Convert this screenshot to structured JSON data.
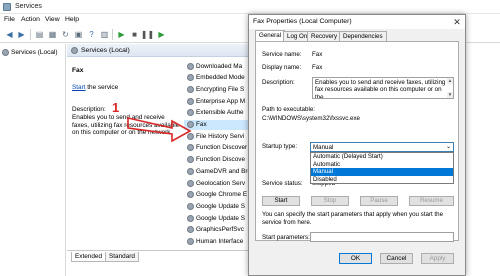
{
  "window": {
    "title": "Services",
    "menu": [
      "File",
      "Action",
      "View",
      "Help"
    ]
  },
  "tree": {
    "root": "Services (Local)"
  },
  "content": {
    "header": "Services (Local)",
    "service_name": "Fax",
    "start_link": "Start",
    "start_suffix": " the service",
    "description_label": "Description:",
    "description_text": "Enables you to send and receive faxes, utilizing fax resources available on this computer or on the network."
  },
  "service_list": [
    "Downloaded Ma",
    "Embedded Mode",
    "Encrypting File S",
    "Enterprise App M",
    "Extensible Authe",
    "Fax",
    "File History Servi",
    "Function Discover",
    "Function Discove",
    "GameDVR and Bro",
    "Geolocation Serv",
    "Google Chrome E",
    "Google Update S",
    "Google Update S",
    "GraphicsPerfSvc",
    "Human Interface"
  ],
  "bottom_tabs": [
    "Extended",
    "Standard"
  ],
  "annotations": {
    "one": "1",
    "two": "2"
  },
  "dialog": {
    "title": "Fax Properties (Local Computer)",
    "close_symbol": "✕",
    "tabs": [
      "General",
      "Log On",
      "Recovery",
      "Dependencies"
    ],
    "service_name_label": "Service name:",
    "service_name_value": "Fax",
    "display_name_label": "Display name:",
    "display_name_value": "Fax",
    "description_label": "Description:",
    "description_value": "Enables you to send and receive faxes, utilizing fax resources available on this computer or on the",
    "path_label": "Path to executable:",
    "path_value": "C:\\WINDOWS\\system32\\fxssvc.exe",
    "startup_type_label": "Startup type:",
    "startup_type_value": "Manual",
    "startup_options": [
      "Automatic (Delayed Start)",
      "Automatic",
      "Manual",
      "Disabled"
    ],
    "highlighted_option": "Manual",
    "service_status_label": "Service status:",
    "service_status_value": "Stopped",
    "buttons": {
      "start": "Start",
      "stop": "Stop",
      "pause": "Pause",
      "resume": "Resume"
    },
    "hint": "You can specify the start parameters that apply when you start the service from here.",
    "start_params_label": "Start parameters:",
    "footer": {
      "ok": "OK",
      "cancel": "Cancel",
      "apply": "Apply"
    }
  },
  "colors": {
    "annotation_red": "#d92828",
    "selection": "#0078d7"
  }
}
